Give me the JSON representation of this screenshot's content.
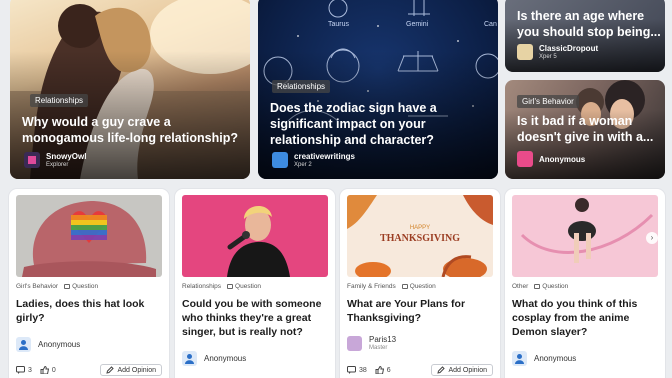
{
  "hero_cards": [
    {
      "category": "Relationships",
      "title": "Why would a guy crave a monogamous life-long relationship?",
      "author": "SnowyOwl",
      "level": "Explorer"
    },
    {
      "category": "Relationships",
      "title": "Does the zodiac sign have a significant impact on your relationship and character?",
      "author": "creativewritings",
      "level": "Xper 2",
      "zodiac": [
        "Taurus",
        "Gemini",
        "Can"
      ]
    },
    {
      "title": "Is there an age where you should stop being...",
      "author": "ClassicDropout",
      "level": "Xper 5"
    },
    {
      "category": "Girl's Behavior",
      "title": "Is it bad if a woman doesn't give in with a...",
      "author": "Anonymous"
    }
  ],
  "cards": [
    {
      "category": "Girl's Behavior",
      "type": "Question",
      "title": "Ladies, does this hat look girly?",
      "author": "Anonymous",
      "opinions": "3",
      "likes": "0",
      "button": "Add Opinion"
    },
    {
      "category": "Relationships",
      "type": "Question",
      "title": "Could you be with someone who thinks they're a great singer, but is really not?",
      "author": "Anonymous"
    },
    {
      "category": "Family & Friends",
      "type": "Question",
      "title": "What are Your Plans for Thanksgiving?",
      "author": "Paris13",
      "level": "Master",
      "opinions": "38",
      "likes": "6",
      "button": "Add Opinion",
      "thumb_text": {
        "line1": "HAPPY",
        "line2": "THANKSGIVING"
      }
    },
    {
      "category": "Other",
      "type": "Question",
      "title": "What do you think of this cosplay from the anime Demon slayer?",
      "author": "Anonymous"
    }
  ],
  "colors": {
    "accent_blue": "#2b6fc7",
    "card_bg": "#ffffff",
    "page_bg": "#ebedf0"
  },
  "icons": [
    "user-avatar-icon",
    "question-icon",
    "opinion-icon",
    "like-icon",
    "add-opinion-icon",
    "chevron-right-icon"
  ]
}
